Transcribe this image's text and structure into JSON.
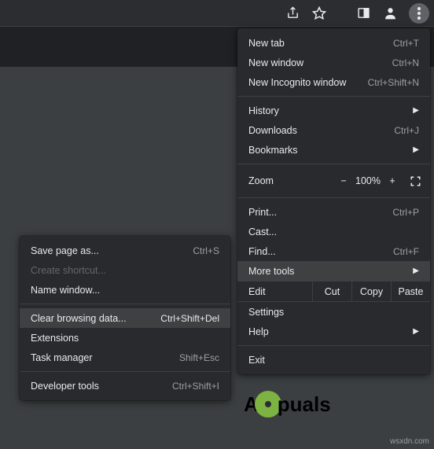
{
  "main_menu": {
    "new_tab": "New tab",
    "new_tab_sc": "Ctrl+T",
    "new_window": "New window",
    "new_window_sc": "Ctrl+N",
    "new_incognito": "New Incognito window",
    "new_incognito_sc": "Ctrl+Shift+N",
    "history": "History",
    "downloads": "Downloads",
    "downloads_sc": "Ctrl+J",
    "bookmarks": "Bookmarks",
    "zoom_label": "Zoom",
    "zoom_minus": "−",
    "zoom_value": "100%",
    "zoom_plus": "+",
    "print": "Print...",
    "print_sc": "Ctrl+P",
    "cast": "Cast...",
    "find": "Find...",
    "find_sc": "Ctrl+F",
    "more_tools": "More tools",
    "edit_label": "Edit",
    "cut": "Cut",
    "copy": "Copy",
    "paste": "Paste",
    "settings": "Settings",
    "help": "Help",
    "exit": "Exit"
  },
  "sub_menu": {
    "save_page": "Save page as...",
    "save_page_sc": "Ctrl+S",
    "create_shortcut": "Create shortcut...",
    "name_window": "Name window...",
    "clear_browsing": "Clear browsing data...",
    "clear_browsing_sc": "Ctrl+Shift+Del",
    "extensions": "Extensions",
    "task_manager": "Task manager",
    "task_manager_sc": "Shift+Esc",
    "developer_tools": "Developer tools",
    "developer_tools_sc": "Ctrl+Shift+I"
  },
  "brand_text_a": "A",
  "brand_text_b": "puals",
  "watermark": "wsxdn.com"
}
